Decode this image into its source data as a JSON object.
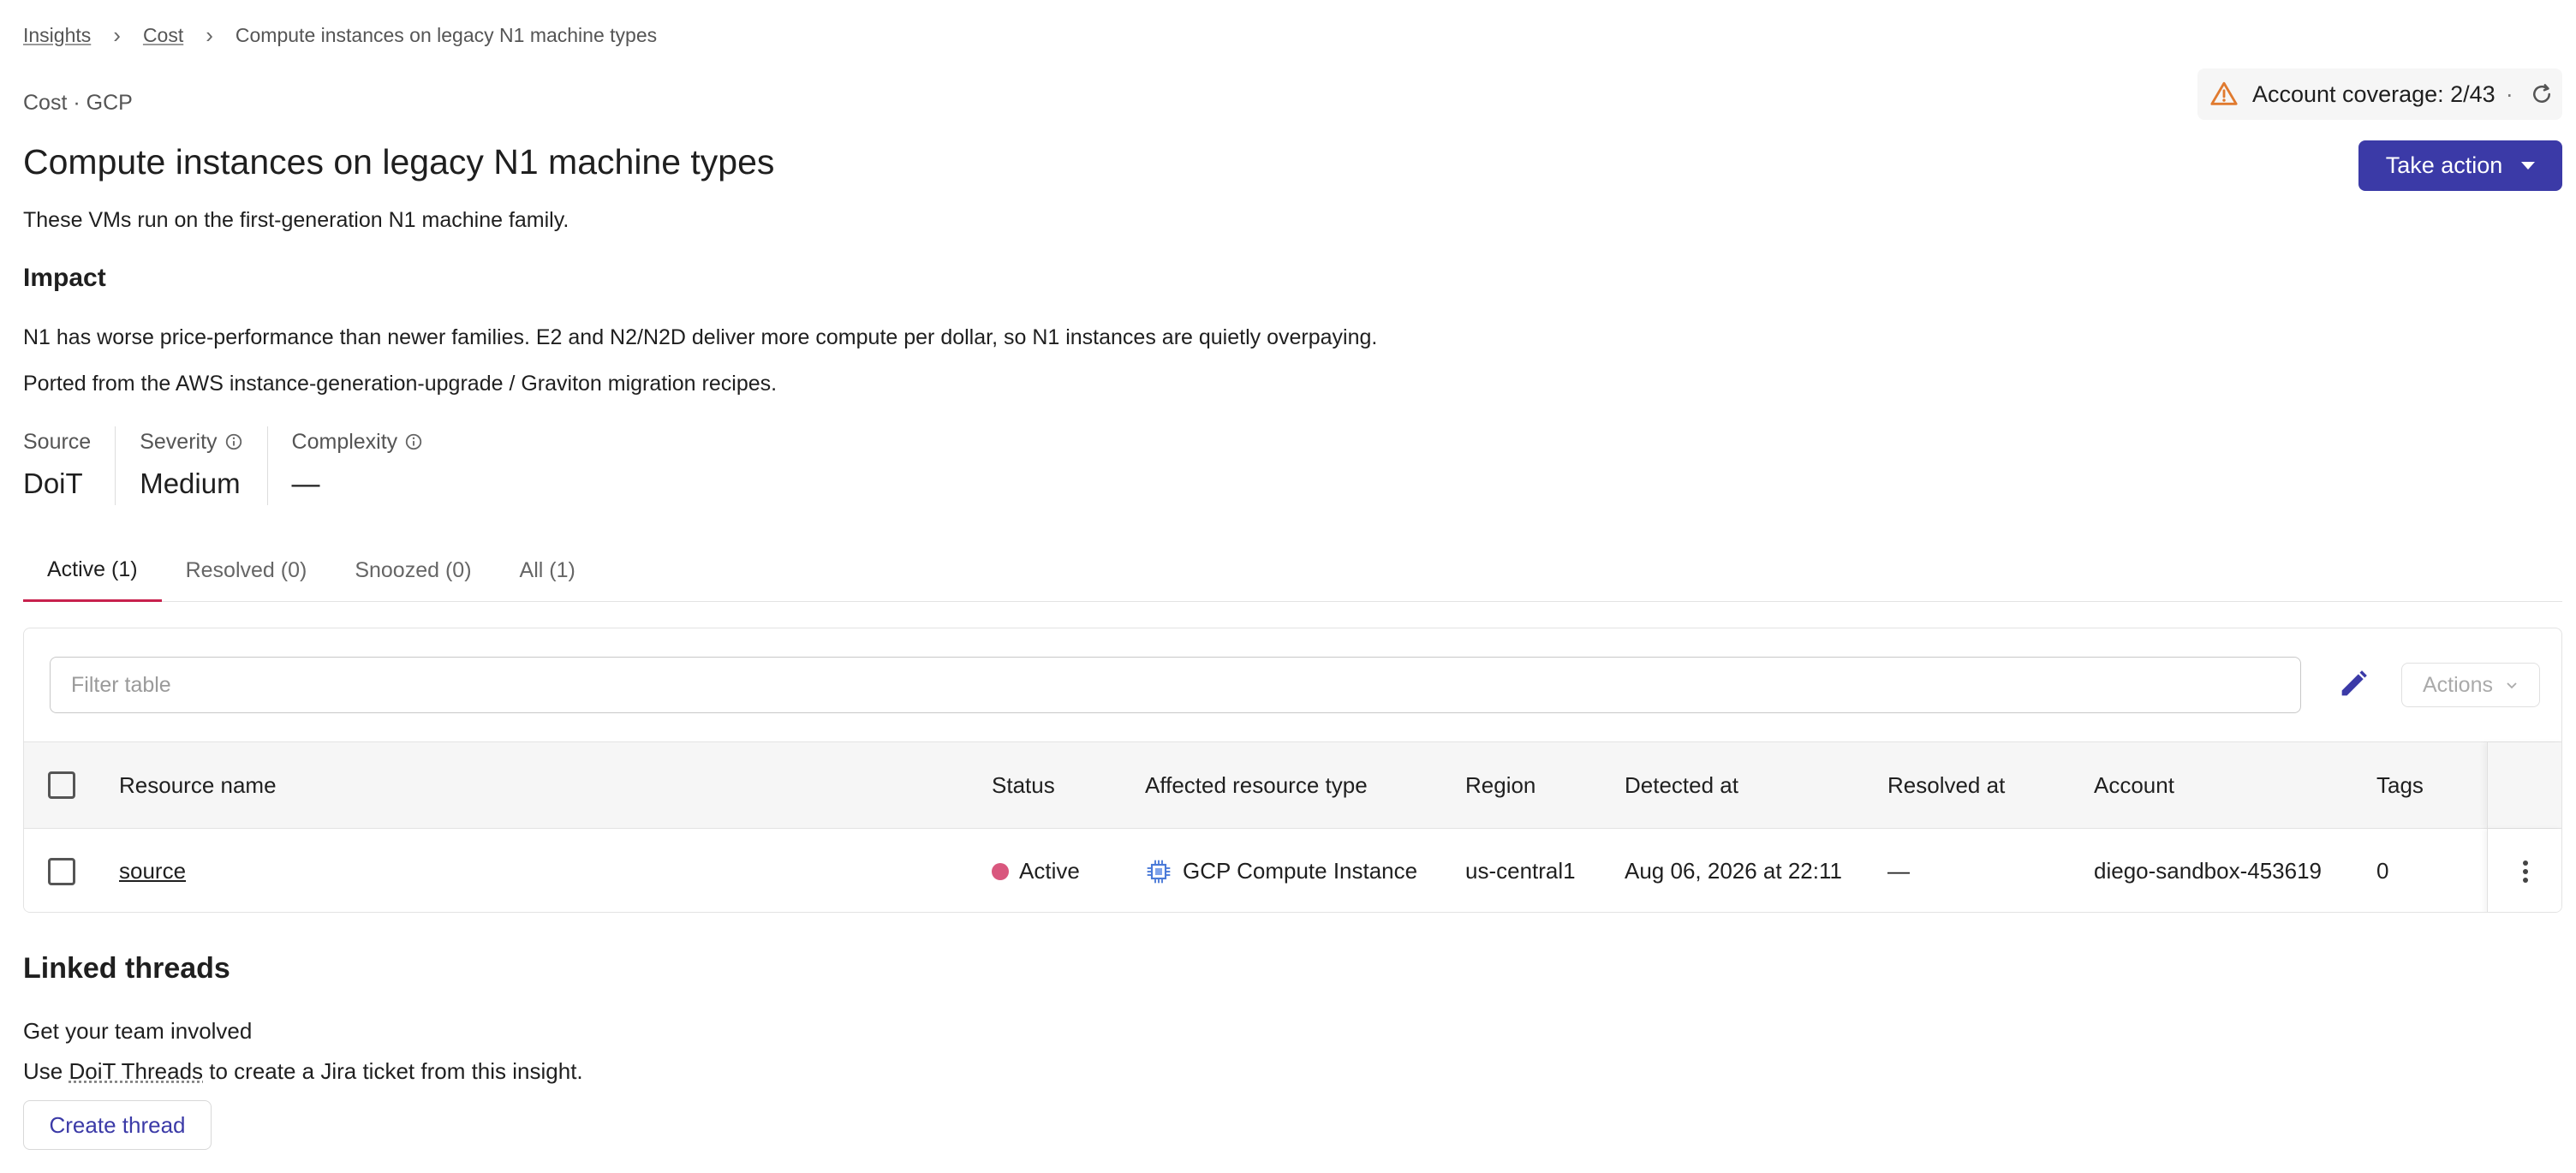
{
  "breadcrumb": {
    "items": [
      {
        "label": "Insights"
      },
      {
        "label": "Cost"
      },
      {
        "label": "Compute instances on legacy N1 machine types"
      }
    ]
  },
  "header": {
    "category": "Cost · GCP",
    "title": "Compute instances on legacy N1 machine types",
    "description": "These VMs run on the first-generation N1 machine family.",
    "coverage_label": "Account coverage: 2/43",
    "coverage_separator": "·",
    "take_action_label": "Take action"
  },
  "impact": {
    "heading": "Impact",
    "line1": "N1 has worse price-performance than newer families. E2 and N2/N2D deliver more compute per dollar, so N1 instances are quietly overpaying.",
    "line2": "Ported from the AWS instance-generation-upgrade / Graviton migration recipes."
  },
  "stats": {
    "source_label": "Source",
    "source_value": "DoiT",
    "severity_label": "Severity",
    "severity_value": "Medium",
    "complexity_label": "Complexity",
    "complexity_value": "—"
  },
  "tabs": [
    {
      "label": "Active (1)",
      "active": true
    },
    {
      "label": "Resolved (0)",
      "active": false
    },
    {
      "label": "Snoozed (0)",
      "active": false
    },
    {
      "label": "All (1)",
      "active": false
    }
  ],
  "table": {
    "filter_placeholder": "Filter table",
    "actions_label": "Actions",
    "columns": [
      "Resource name",
      "Status",
      "Affected resource type",
      "Region",
      "Detected at",
      "Resolved at",
      "Account",
      "Tags"
    ],
    "rows": [
      {
        "resource_name": "source",
        "status": "Active",
        "resource_type": "GCP Compute Instance",
        "region": "us-central1",
        "detected_at": "Aug 06, 2026 at 22:11",
        "resolved_at": "—",
        "account": "diego-sandbox-453619",
        "tags": "0"
      }
    ]
  },
  "linked_threads": {
    "title": "Linked threads",
    "subtitle": "Get your team involved",
    "desc_prefix": "Use ",
    "desc_link": "DoiT Threads",
    "desc_suffix": " to create a Jira ticket from this insight.",
    "button_label": "Create thread"
  },
  "colors": {
    "primary": "#3b3aa7",
    "active_tab_underline": "#c8214d",
    "status_active": "#d9577e",
    "warning": "#e07a2f"
  },
  "icons": [
    "chevron-right-icon",
    "warning-icon",
    "refresh-icon",
    "info-icon",
    "pencil-icon",
    "chevron-down-icon",
    "gcp-compute-icon",
    "more-vertical-icon"
  ]
}
